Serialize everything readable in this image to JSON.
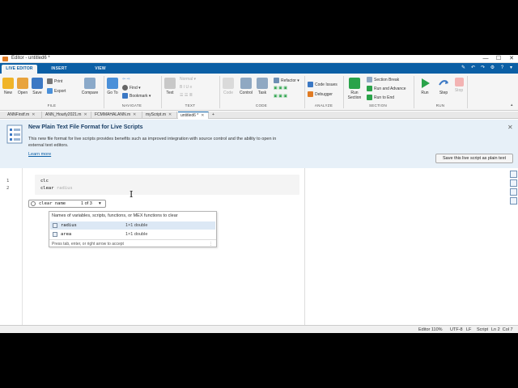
{
  "window": {
    "title": "Editor - untitled6 *",
    "minimize": "—",
    "maximize": "☐",
    "close": "✕"
  },
  "ribbon_tabs": [
    "LIVE EDITOR",
    "INSERT",
    "VIEW"
  ],
  "quick_access": [
    "✎",
    "↶",
    "↷",
    "⚙",
    "?",
    "▾"
  ],
  "toolstrip": {
    "file": {
      "new": "New",
      "open": "Open",
      "save": "Save",
      "print": "Print",
      "export": "Export",
      "compare": "Compare",
      "group": "FILE"
    },
    "navigate": {
      "goto": "Go To",
      "find": "Find",
      "bookmark": "Bookmark",
      "group": "NAVIGATE"
    },
    "text": {
      "normal": "Normal",
      "text_btn": "Text",
      "group": "TEXT"
    },
    "code": {
      "code_btn": "Code",
      "control": "Control",
      "task": "Task",
      "refactor": "Refactor",
      "group": "CODE"
    },
    "analyze": {
      "code_issues": "Code Issues",
      "debugger": "Debugger",
      "group": "ANALYZE"
    },
    "section": {
      "run_section": "Run\nSection",
      "section_break": "Section Break",
      "run_advance": "Run and Advance",
      "run_end": "Run to End",
      "group": "SECTION"
    },
    "run": {
      "run": "Run",
      "step": "Step",
      "stop": "Stop",
      "group": "RUN"
    }
  },
  "doc_tabs": [
    "ANNFirstf.m",
    "ANN_Hourly2021.m",
    "FCMMAHALANN.m",
    "myScript.m",
    "untitled6 *"
  ],
  "banner": {
    "title": "New Plain Text File Format for Live Scripts",
    "body": "This new file format for live scripts provides benefits such as improved integration with source control and the ability to open in external text editors.",
    "link": "Learn more",
    "button": "Save this live script as plain text",
    "close": "✕"
  },
  "editor": {
    "line_numbers": [
      "1",
      "2"
    ],
    "line1": "clc",
    "line2_typed": "clear ",
    "line2_ghost": "radius"
  },
  "autocomplete": {
    "hint_text": "clear name",
    "hint_count": "1 of 3",
    "header": "Names of variables, scripts, functions, or MEX functions to clear",
    "items": [
      {
        "name": "radius",
        "size": "1×1 double"
      },
      {
        "name": "area",
        "size": "1×1 double"
      }
    ],
    "footer": "Press tab, enter, or right arrow to accept"
  },
  "status_bar": {
    "zoom": "Editor 110%",
    "encoding": "UTF-8",
    "eol": "LF",
    "type": "Script",
    "position": "Ln 2  Col 7"
  },
  "colors": {
    "accent": "#0b5fa5",
    "banner_bg": "#e7f0f8",
    "run_green": "#2aa34a",
    "stop_red": "#e04848"
  }
}
